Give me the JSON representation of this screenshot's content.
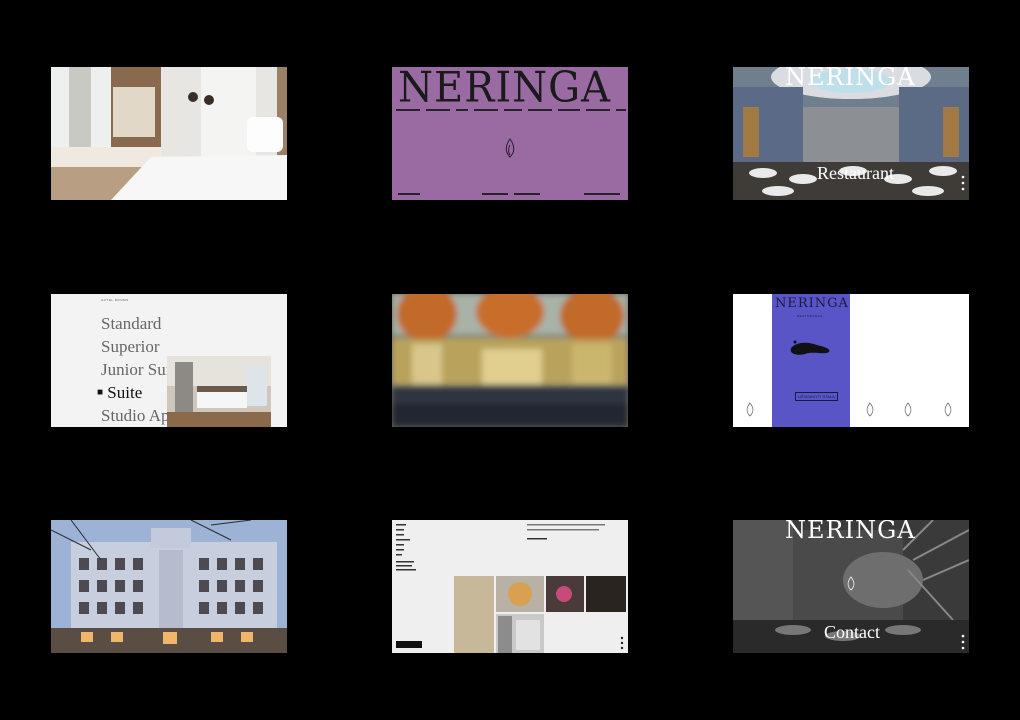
{
  "brand": {
    "logo_text": "NERINGA",
    "restaurant_sub": "RESTORANAS"
  },
  "colors": {
    "background": "#000000",
    "purple": "#9a6aa3",
    "blue": "#5a55c7",
    "ink": "#1a1a1a"
  },
  "cards": {
    "restaurant": {
      "title": "Restaurant"
    },
    "rooms": {
      "header": "HOTEL ROOMS",
      "items": [
        "Standard",
        "Superior",
        "Junior Suite",
        "Suite",
        "Studio Apartment"
      ],
      "active_index": 3
    },
    "restaurant_page": {
      "button": "UŽSISAKYTI STALĄ"
    },
    "contact": {
      "title": "Contact"
    }
  },
  "icons": [
    "flame-logo-icon",
    "menu-dots-icon",
    "scroll-dots-icon"
  ]
}
